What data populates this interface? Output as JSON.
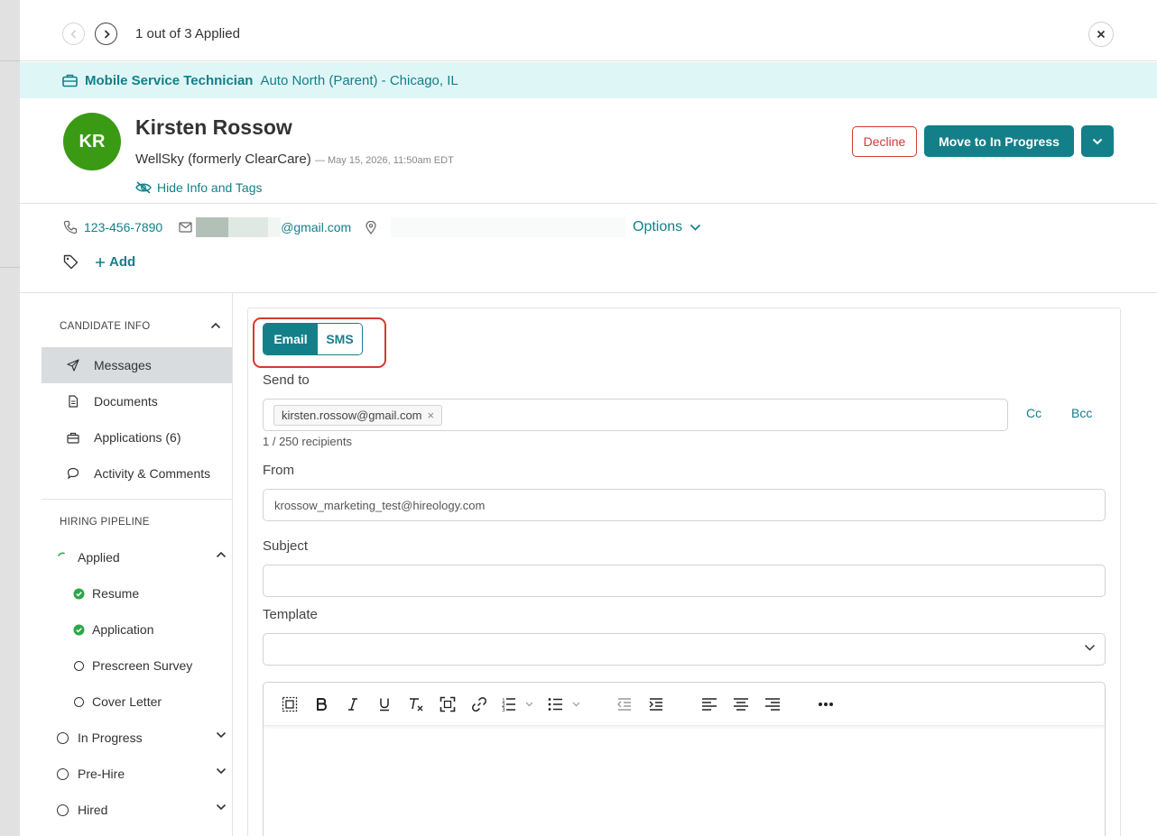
{
  "nav": {
    "count_text": "1 out of 3 Applied"
  },
  "job": {
    "title": "Mobile Service Technician",
    "location": "Auto North (Parent) - Chicago, IL"
  },
  "candidate": {
    "initials": "KR",
    "name": "Kirsten Rossow",
    "source": "WellSky (formerly ClearCare)",
    "date": "— May 15, 2026, 11:50am EDT",
    "hide_info_label": "Hide Info and Tags",
    "phone": "123-456-7890",
    "email_domain": "@gmail.com",
    "options_label": "Options",
    "add_tag_label": "Add"
  },
  "actions": {
    "decline": "Decline",
    "move": "Move to In Progress"
  },
  "sidebar": {
    "candidate_info_heading": "CANDIDATE INFO",
    "items": [
      {
        "label": "Messages",
        "icon": "send-icon",
        "active": true
      },
      {
        "label": "Documents",
        "icon": "document-icon"
      },
      {
        "label": "Applications (6)",
        "icon": "briefcase-icon"
      },
      {
        "label": "Activity & Comments",
        "icon": "comment-icon"
      }
    ],
    "pipeline_heading": "HIRING PIPELINE",
    "pipeline": [
      {
        "label": "Applied",
        "state": "in-progress",
        "expanded": true
      },
      {
        "label": "Resume",
        "state": "complete",
        "sub": true
      },
      {
        "label": "Application",
        "state": "complete",
        "sub": true
      },
      {
        "label": "Prescreen Survey",
        "state": "pending",
        "sub": true
      },
      {
        "label": "Cover Letter",
        "state": "pending",
        "sub": true
      },
      {
        "label": "In Progress",
        "state": "pending"
      },
      {
        "label": "Pre-Hire",
        "state": "pending"
      },
      {
        "label": "Hired",
        "state": "pending"
      }
    ]
  },
  "compose": {
    "tabs": {
      "email": "Email",
      "sms": "SMS",
      "selected": "Email"
    },
    "send_to_label": "Send to",
    "recipient_chip": "kirsten.rossow@gmail.com",
    "chip_remove": "×",
    "cc": "Cc",
    "bcc": "Bcc",
    "recipients_count": "1 / 250 recipients",
    "from_label": "From",
    "from_value": "krossow_marketing_test@hireology.com",
    "subject_label": "Subject",
    "subject_value": "",
    "template_label": "Template",
    "template_value": ""
  },
  "colors": {
    "accent": "#137f89",
    "banner_bg": "#dff6f7",
    "avatar": "#3b9a14",
    "decline": "#cf3b3b",
    "highlight": "#d33a2c",
    "complete": "#2ba84a"
  }
}
